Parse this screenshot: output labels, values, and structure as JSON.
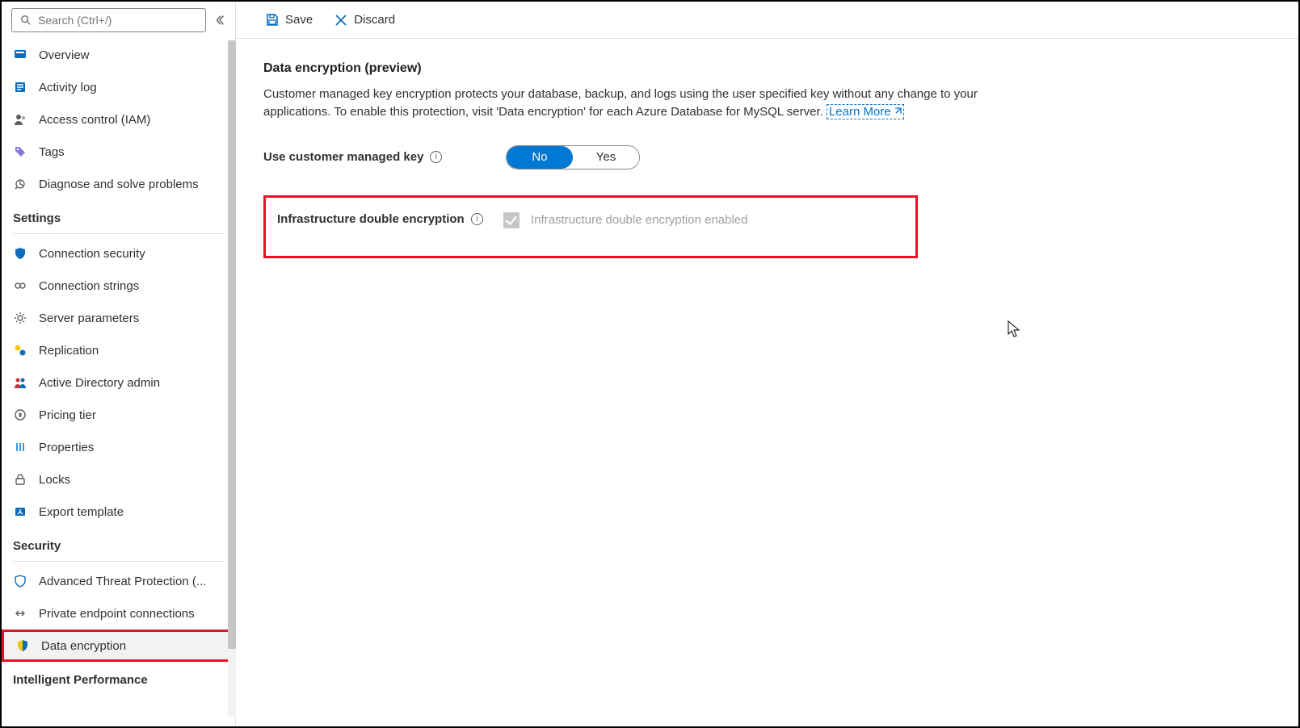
{
  "search": {
    "placeholder": "Search (Ctrl+/)"
  },
  "sidebar": {
    "items_top": [
      {
        "label": "Overview",
        "icon": "overview"
      },
      {
        "label": "Activity log",
        "icon": "activity"
      },
      {
        "label": "Access control (IAM)",
        "icon": "iam"
      },
      {
        "label": "Tags",
        "icon": "tags"
      },
      {
        "label": "Diagnose and solve problems",
        "icon": "diagnose"
      }
    ],
    "section_settings": "Settings",
    "items_settings": [
      {
        "label": "Connection security",
        "icon": "shield-blue"
      },
      {
        "label": "Connection strings",
        "icon": "connection"
      },
      {
        "label": "Server parameters",
        "icon": "gear"
      },
      {
        "label": "Replication",
        "icon": "replication"
      },
      {
        "label": "Active Directory admin",
        "icon": "ad"
      },
      {
        "label": "Pricing tier",
        "icon": "pricing"
      },
      {
        "label": "Properties",
        "icon": "properties"
      },
      {
        "label": "Locks",
        "icon": "lock"
      },
      {
        "label": "Export template",
        "icon": "export"
      }
    ],
    "section_security": "Security",
    "items_security": [
      {
        "label": "Advanced Threat Protection (...",
        "icon": "shield-outline"
      },
      {
        "label": "Private endpoint connections",
        "icon": "endpoint"
      },
      {
        "label": "Data encryption",
        "icon": "shield-color",
        "selected": true
      }
    ],
    "section_intelligent": "Intelligent Performance"
  },
  "toolbar": {
    "save": "Save",
    "discard": "Discard"
  },
  "main": {
    "title": "Data encryption (preview)",
    "desc_part1": "Customer managed key encryption protects your database, backup, and logs using the user specified key without any change to your applications. To enable this protection, visit 'Data encryption' for each Azure Database for MySQL server. ",
    "learn_more": "Learn More",
    "cmk_label": "Use customer managed key",
    "toggle_no": "No",
    "toggle_yes": "Yes",
    "infra_label": "Infrastructure double encryption",
    "infra_chk_label": "Infrastructure double encryption enabled"
  },
  "icons": {
    "search": "search-icon",
    "collapse": "chevron-left-double-icon",
    "save": "save-icon",
    "discard": "close-icon",
    "info": "info-icon",
    "external": "external-link-icon"
  }
}
